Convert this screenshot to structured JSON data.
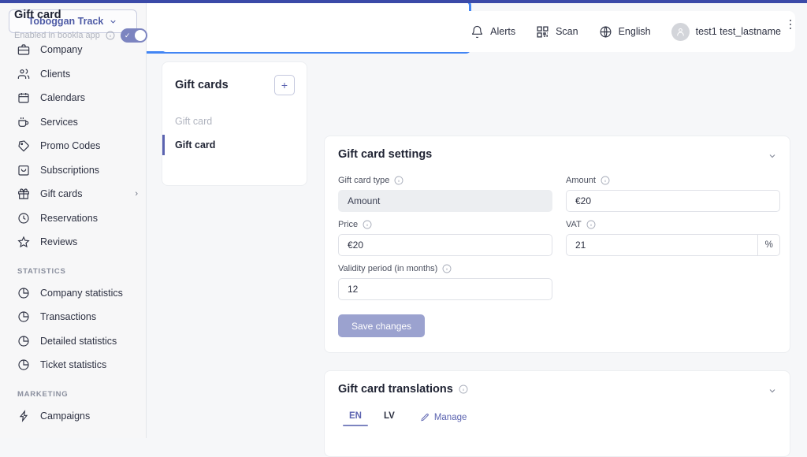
{
  "colors": {
    "topbar": "#3b4aa8",
    "accent": "#5b63b0",
    "highlight": "#4285f4",
    "toggle_on": "#7c84c0",
    "save_button": "#9ba2cf",
    "page_bg": "#f6f7f9",
    "sidebar_bg": "#f7f7f8"
  },
  "sidebar": {
    "brand": {
      "label": "Toboggan Track",
      "icon": "chevron-down-icon"
    },
    "items": [
      {
        "label": "Company",
        "icon": "briefcase-icon"
      },
      {
        "label": "Clients",
        "icon": "users-icon"
      },
      {
        "label": "Calendars",
        "icon": "calendar-icon"
      },
      {
        "label": "Services",
        "icon": "cup-icon"
      },
      {
        "label": "Promo Codes",
        "icon": "tag-icon"
      },
      {
        "label": "Subscriptions",
        "icon": "bag-icon"
      },
      {
        "label": "Gift cards",
        "icon": "gift-icon",
        "chevron": "›"
      },
      {
        "label": "Reservations",
        "icon": "clock-icon"
      },
      {
        "label": "Reviews",
        "icon": "star-icon"
      }
    ],
    "statistics_header": "STATISTICS",
    "statistics_items": [
      {
        "label": "Company statistics",
        "icon": "pie-chart-icon"
      },
      {
        "label": "Transactions",
        "icon": "pie-chart-icon"
      },
      {
        "label": "Detailed statistics",
        "icon": "pie-chart-icon"
      },
      {
        "label": "Ticket statistics",
        "icon": "pie-chart-icon"
      }
    ],
    "marketing_header": "MARKETING",
    "marketing_items": [
      {
        "label": "Campaigns",
        "icon": "lightning-icon"
      }
    ]
  },
  "header": {
    "alerts": {
      "label": "Alerts",
      "icon": "bell-icon"
    },
    "scan": {
      "label": "Scan",
      "icon": "qr-code-icon"
    },
    "language": {
      "label": "English",
      "icon": "globe-icon"
    },
    "user": {
      "name": "test1 test_lastname",
      "icon": "user-avatar-icon"
    }
  },
  "list_panel": {
    "title": "Gift cards",
    "add_label": "+",
    "rows": [
      {
        "label": "Gift card",
        "state": "muted"
      },
      {
        "label": "Gift card",
        "state": "active"
      }
    ]
  },
  "gift_card": {
    "title": "Gift card",
    "enabled_label": "Enabled in bookla app",
    "toggle_on": true,
    "check_glyph": "✓",
    "menu_icon": "kebab-menu-icon"
  },
  "settings": {
    "title": "Gift card settings",
    "collapse_glyph": "⌄",
    "fields": {
      "type": {
        "label": "Gift card type",
        "value": "Amount"
      },
      "amount": {
        "label": "Amount",
        "value": "€20"
      },
      "price": {
        "label": "Price",
        "value": "€20"
      },
      "vat": {
        "label": "VAT",
        "value": "21",
        "suffix": "%"
      },
      "validity": {
        "label": "Validity period (in months)",
        "value": "12"
      }
    },
    "save_label": "Save changes"
  },
  "translations": {
    "title": "Gift card translations",
    "collapse_glyph": "⌄",
    "tabs": [
      {
        "label": "EN",
        "active": true
      },
      {
        "label": "LV",
        "active": false
      }
    ],
    "manage_label": "Manage",
    "manage_icon": "pencil-icon"
  }
}
